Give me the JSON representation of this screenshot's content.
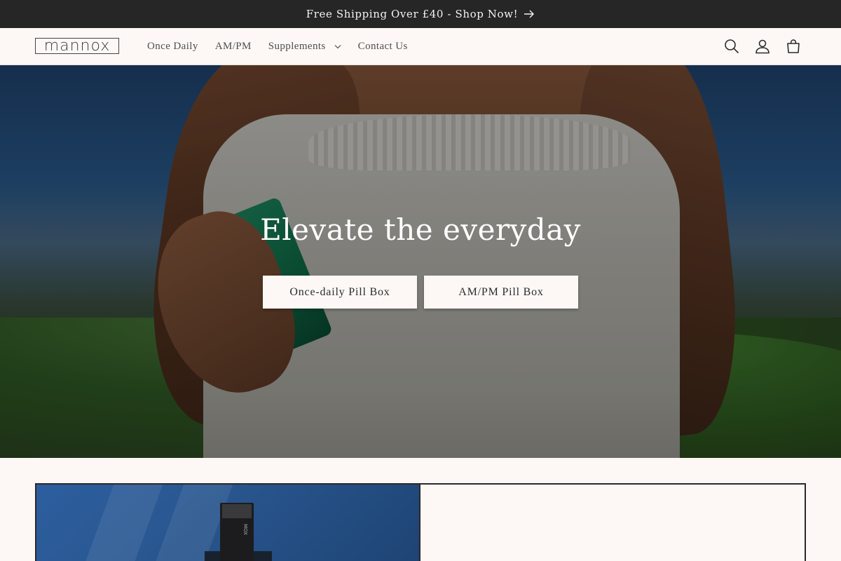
{
  "announcement": {
    "text": "Free Shipping Over £40 - Shop Now!",
    "icon": "arrow-right-icon"
  },
  "header": {
    "logo_text": "mannox",
    "nav": [
      {
        "label": "Once Daily",
        "has_dropdown": false
      },
      {
        "label": "AM/PM",
        "has_dropdown": false
      },
      {
        "label": "Supplements",
        "has_dropdown": true
      },
      {
        "label": "Contact Us",
        "has_dropdown": false
      }
    ],
    "icons": [
      "search-icon",
      "account-icon",
      "cart-icon"
    ]
  },
  "hero": {
    "heading": "Elevate the everyday",
    "buttons": [
      {
        "label": "Once-daily Pill Box"
      },
      {
        "label": "AM/PM Pill Box"
      }
    ]
  },
  "lower_section": {
    "device_label": "MOX"
  },
  "colors": {
    "announcement_bg": "#262626",
    "page_bg": "#fdf8f6",
    "text": "#2b2b2b",
    "pillbox_green": "#1e8a62",
    "feature_bg": "#2c5e9e"
  }
}
